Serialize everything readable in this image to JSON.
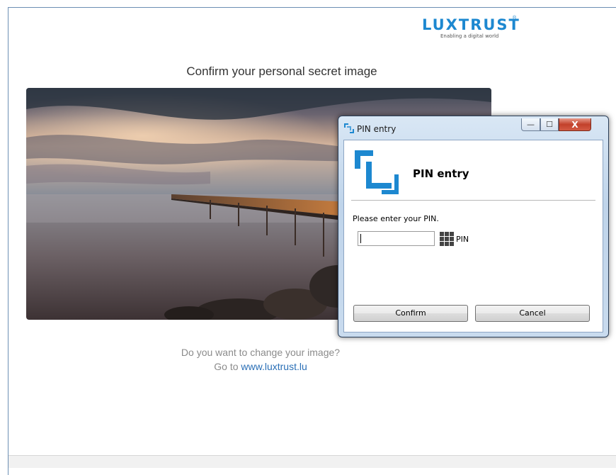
{
  "logo": {
    "text": "LUXTRUST",
    "registered": "®",
    "tagline": "Enabling a digital world",
    "color": "#1d88d0"
  },
  "page": {
    "heading": "Confirm your personal secret image",
    "change_question": "Do you want to change your image?",
    "go_to": "Go to",
    "link": "www.luxtrust.lu",
    "link_color": "#2a6fb6"
  },
  "dialog": {
    "window_title": "PIN entry",
    "header_title": "PIN entry",
    "prompt": "Please enter your PIN.",
    "pin_value": "",
    "pin_label": "PIN",
    "confirm_label": "Confirm",
    "cancel_label": "Cancel",
    "minimize_glyph": "—",
    "maximize_glyph": "☐",
    "close_glyph": "X",
    "accent": "#1d88d0"
  },
  "icons": {
    "title_icon": "luxtrust-bracket-icon",
    "header_icon": "luxtrust-bracket-icon",
    "keypad": "keypad-grid-icon"
  }
}
